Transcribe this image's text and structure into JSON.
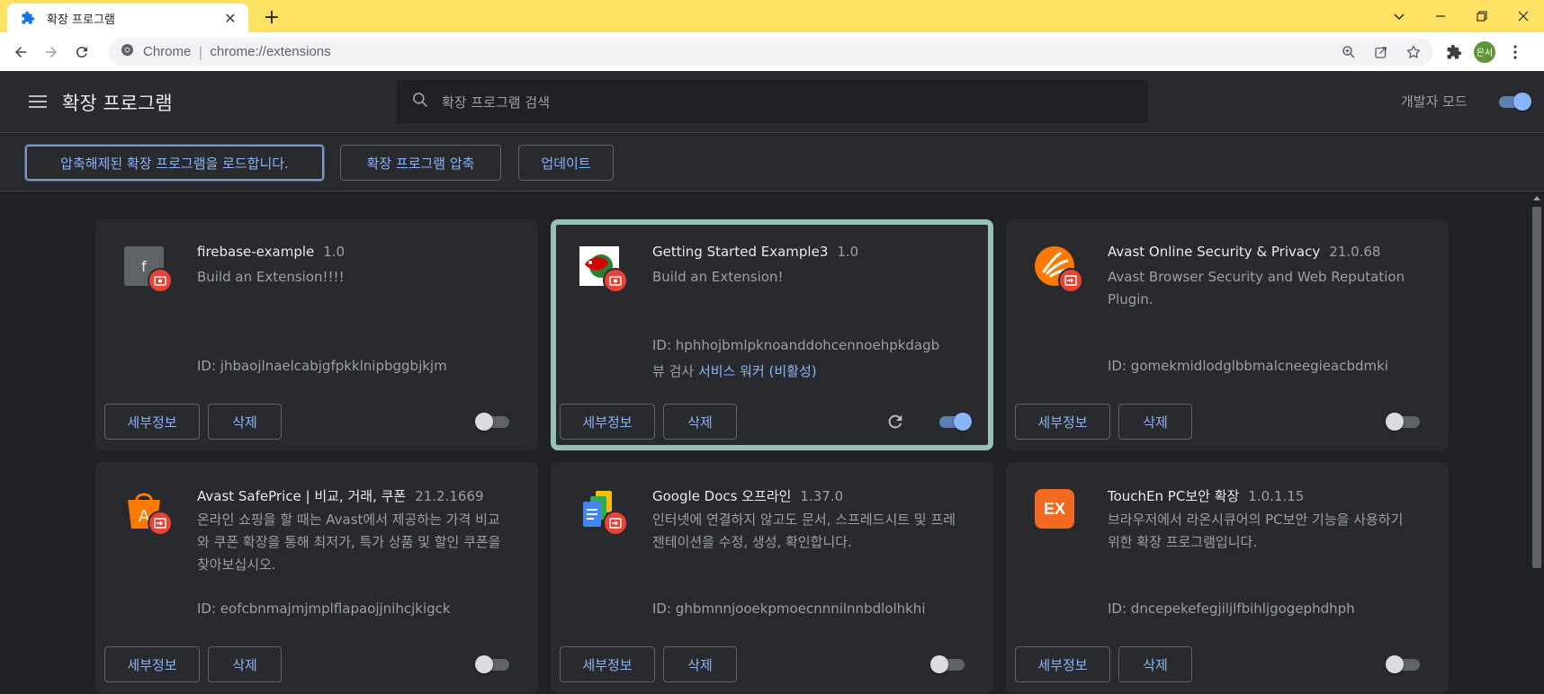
{
  "browser": {
    "tab_title": "확장 프로그램",
    "site_label": "Chrome",
    "url_separator": "|",
    "url": "chrome://extensions",
    "profile_initials": "은서"
  },
  "header": {
    "title": "확장 프로그램",
    "search_placeholder": "확장 프로그램 검색",
    "dev_mode_label": "개발자 모드",
    "dev_mode_on": true
  },
  "actions": {
    "load_unpacked": "압축해제된 확장 프로그램을 로드합니다.",
    "pack": "확장 프로그램 압축",
    "update": "업데이트"
  },
  "card_labels": {
    "details": "세부정보",
    "remove": "삭제",
    "inspect_prefix": "뷰 검사",
    "service_worker_link": "서비스 워커 (비활성)"
  },
  "extensions": [
    {
      "name": "firebase-example",
      "version": "1.0",
      "description": "Build an Extension!!!!",
      "id": "ID: jhbaojlnaelcabjgfpkklnipbggbjkjm",
      "enabled": false
    },
    {
      "name": "Getting Started Example3",
      "version": "1.0",
      "description": "Build an Extension!",
      "id": "ID: hphhojbmlpknoanddohcennoehpkdagb",
      "enabled": true
    },
    {
      "name": "Avast Online Security & Privacy",
      "version": "21.0.68",
      "description": "Avast Browser Security and Web Reputation Plugin.",
      "id": "ID: gomekmidlodglbbmalcneegieacbdmki",
      "enabled": false
    },
    {
      "name": "Avast SafePrice | 비교, 거래, 쿠폰",
      "version": "21.2.1669",
      "description": "온라인 쇼핑을 할 때는 Avast에서 제공하는 가격 비교와 쿠폰 확장을 통해 최저가, 특가 상품 및 할인 쿠폰을 찾아보십시오.",
      "id": "ID: eofcbnmajmjmplflapaojjnihcjkigck",
      "enabled": false
    },
    {
      "name": "Google Docs 오프라인",
      "version": "1.37.0",
      "description": "인터넷에 연결하지 않고도 문서, 스프레드시트 및 프레젠테이션을 수정, 생성, 확인합니다.",
      "id": "ID: ghbmnnjooekpmoecnnnilnnbdlolhkhi",
      "enabled": false
    },
    {
      "name": "TouchEn PC보안 확장",
      "version": "1.0.1.15",
      "description": "브라우저에서 라온시큐어의 PC보안 기능을 사용하기 위한 확장 프로그램입니다.",
      "id": "ID: dncepekefegjiljlfbihljgogephdhph",
      "enabled": false,
      "icon_text": "EX"
    }
  ],
  "colors": {
    "accent": "#8ab4f8",
    "highlight_border": "#95c2b5",
    "tab_strip": "#fde263",
    "badge": "#ea4335"
  }
}
